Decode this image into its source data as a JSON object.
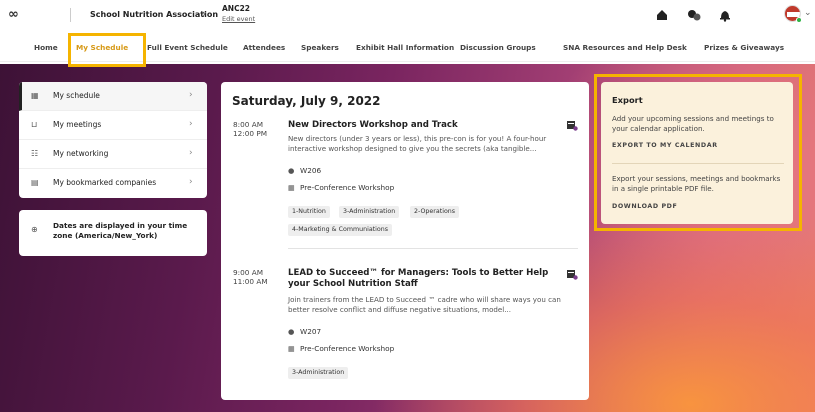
{
  "header": {
    "org_name": "School Nutrition Association",
    "event_code": "ANC22",
    "edit_event_label": "Edit event"
  },
  "nav": {
    "items": [
      {
        "label": "Home"
      },
      {
        "label": "My Schedule"
      },
      {
        "label": "Full Event Schedule"
      },
      {
        "label": "Attendees"
      },
      {
        "label": "Speakers"
      },
      {
        "label": "Exhibit Hall Information"
      },
      {
        "label": "Discussion Groups"
      },
      {
        "label": "SNA Resources and Help Desk"
      },
      {
        "label": "Prizes & Giveaways"
      }
    ],
    "active": "My Schedule"
  },
  "sidebar": {
    "items": [
      {
        "label": "My schedule"
      },
      {
        "label": "My meetings"
      },
      {
        "label": "My networking"
      },
      {
        "label": "My bookmarked companies"
      }
    ]
  },
  "timezone_note": "Dates are displayed in your time zone (America/New_York)",
  "schedule": {
    "date_heading": "Saturday, July 9, 2022",
    "sessions": [
      {
        "start": "8:00 AM",
        "end": "12:00 PM",
        "title": "New Directors Workshop and Track",
        "description": "New directors (under 3 years or less), this pre-con is for you! A four-hour interactive workshop designed to give you the secrets (aka tangible...",
        "room": "W206",
        "type": "Pre-Conference Workshop",
        "tags": [
          "1-Nutrition",
          "3-Administration",
          "2-Operations",
          "4-Marketing & Communiations"
        ]
      },
      {
        "start": "9:00 AM",
        "end": "11:00 AM",
        "title": "LEAD to Succeed™ for Managers: Tools to Better Help your School Nutrition Staff",
        "description": "Join trainers from the LEAD to Succeed ™ cadre who will share ways you can better resolve conflict and diffuse negative situations, model...",
        "room": "W207",
        "type": "Pre-Conference Workshop",
        "tags": [
          "3-Administration"
        ]
      }
    ]
  },
  "export": {
    "title": "Export",
    "calendar_text": "Add your upcoming sessions and meetings to your calendar application.",
    "calendar_link": "EXPORT TO MY CALENDAR",
    "pdf_text": "Export your sessions, meetings and bookmarks in a single printable PDF file.",
    "pdf_link": "DOWNLOAD PDF"
  },
  "colors": {
    "accent": "#d79a18",
    "highlight": "#f5b400",
    "export_bg": "#fbf1dc"
  },
  "icons": {
    "logo": "infinity-icon",
    "home": "home-icon",
    "chat": "chat-icon",
    "notifications": "bell-icon",
    "bookmark": "bookmark-calendar-icon",
    "location": "location-pin-icon",
    "session_type": "session-type-icon"
  }
}
